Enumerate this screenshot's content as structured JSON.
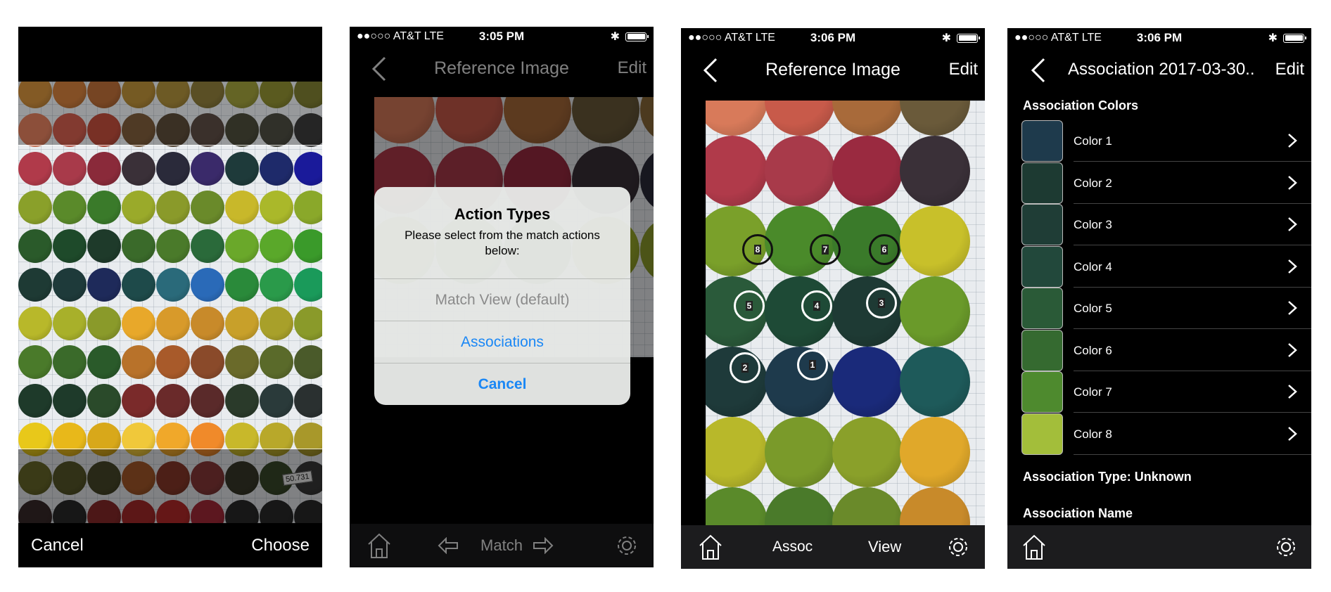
{
  "screen1": {
    "cancel_label": "Cancel",
    "choose_label": "Choose",
    "stamp_text": "50.731"
  },
  "screen2": {
    "status": {
      "carrier": "●●○○○ AT&T  LTE",
      "time": "3:05 PM"
    },
    "nav": {
      "title": "Reference Image",
      "edit_label": "Edit"
    },
    "alert": {
      "title": "Action Types",
      "message": "Please select from the match actions below:",
      "actions": [
        "Match View (default)",
        "Associations",
        "Cancel"
      ]
    },
    "tabbar": {
      "match_label": "Match"
    }
  },
  "screen3": {
    "status": {
      "carrier": "●●○○○ AT&T  LTE",
      "time": "3:06 PM"
    },
    "nav": {
      "title": "Reference Image",
      "edit_label": "Edit"
    },
    "markers": [
      "8",
      "7",
      "6",
      "5",
      "4",
      "3",
      "2",
      "1"
    ],
    "tabbar": {
      "assoc_label": "Assoc",
      "view_label": "View"
    }
  },
  "screen4": {
    "status": {
      "carrier": "●●○○○ AT&T  LTE",
      "time": "3:06 PM"
    },
    "nav": {
      "title": "Association 2017-03-30...",
      "edit_label": "Edit"
    },
    "section_title": "Association Colors",
    "colors": [
      {
        "label": "Color 1",
        "swatch": "#1e3a4c"
      },
      {
        "label": "Color 2",
        "swatch": "#1d3a32"
      },
      {
        "label": "Color 3",
        "swatch": "#1f3d36"
      },
      {
        "label": "Color 4",
        "swatch": "#22483b"
      },
      {
        "label": "Color 5",
        "swatch": "#2a5a37"
      },
      {
        "label": "Color 6",
        "swatch": "#356a30"
      },
      {
        "label": "Color 7",
        "swatch": "#4e8a2e"
      },
      {
        "label": "Color 8",
        "swatch": "#a3be3a"
      }
    ],
    "association_type": "Association Type: Unknown",
    "association_name": "Association Name"
  },
  "accent_color": "#1a87f5"
}
